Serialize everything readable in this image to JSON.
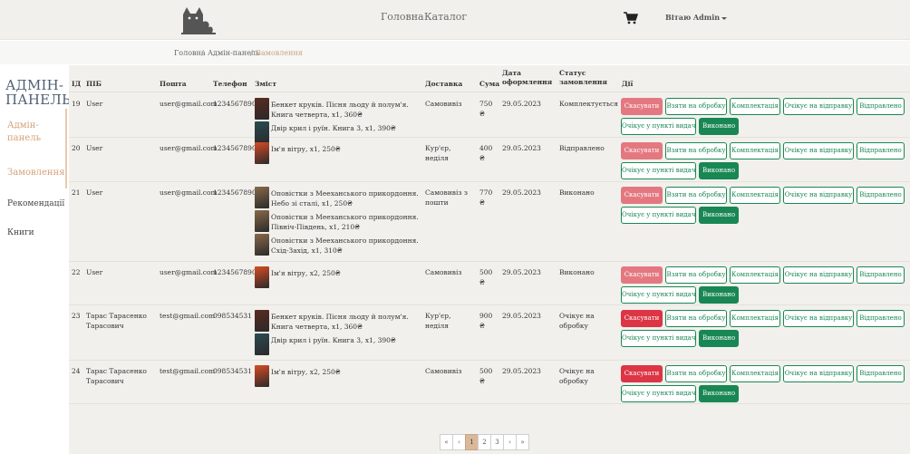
{
  "header": {
    "nav": [
      "Головна",
      "Каталог"
    ],
    "greeting": "Вітаю Admin"
  },
  "breadcrumb": [
    "Головна",
    "/",
    "Адмін-панель",
    "/",
    "Замовлення"
  ],
  "sidebar": {
    "title": "АДМІН-ПАНЕЛЬ",
    "items": [
      "Адмін-панель",
      "Замовлення",
      "Рекомендації",
      "Книги"
    ]
  },
  "table": {
    "headers": {
      "id": "ІД",
      "name": "ПІБ",
      "email": "Пошта",
      "phone": "Телефон",
      "content": "Зміст",
      "delivery": "Доставка",
      "sum": "Сума",
      "date": "Дата оформлення",
      "status": "Статус замовлення",
      "actions": "Дії"
    },
    "rows": [
      {
        "id": "19",
        "name": "User",
        "email": "user@gmail.com",
        "phone": "1234567890",
        "items": [
          "Бенкет круків. Пісня льоду й полум'я. Книга четверта, x1, 360₴",
          "Двір крил і руїн. Книга 3, x1, 390₴"
        ],
        "delivery": "Самовивіз",
        "sum": "750 ₴",
        "date": "29.05.2023",
        "status": "Комплектується"
      },
      {
        "id": "20",
        "name": "User",
        "email": "user@gmail.com",
        "phone": "1234567890",
        "items": [
          "Ім'я вітру, x1, 250₴"
        ],
        "delivery": "Кур'єр, неділя",
        "sum": "400 ₴",
        "date": "29.05.2023",
        "status": "Відправлено"
      },
      {
        "id": "21",
        "name": "User",
        "email": "user@gmail.com",
        "phone": "1234567890",
        "items": [
          "Оповістки з Мееханського прикордоння. Небо зі сталі, x1, 250₴",
          "Оповістки з Мееханського прикордоння. Північ-Південь, x1, 210₴",
          "Оповістки з Мееханського прикордоння. Схід-Захід, x1, 310₴"
        ],
        "delivery": "Самовивіз з пошти",
        "sum": "770 ₴",
        "date": "29.05.2023",
        "status": "Виконано"
      },
      {
        "id": "22",
        "name": "User",
        "email": "user@gmail.com",
        "phone": "1234567890",
        "items": [
          "Ім'я вітру, x2, 250₴"
        ],
        "delivery": "Самовивіз",
        "sum": "500 ₴",
        "date": "29.05.2023",
        "status": "Виконано"
      },
      {
        "id": "23",
        "name": "Тарас Тарасенко Тарасович",
        "email": "test@gmail.com",
        "phone": "098534531",
        "items": [
          "Бенкет круків. Пісня льоду й полум'я. Книга четверта, x1, 360₴",
          "Двір крил і руїн. Книга 3, x1, 390₴"
        ],
        "delivery": "Кур'єр, неділя",
        "sum": "900 ₴",
        "date": "29.05.2023",
        "status": "Очікує на обробку"
      },
      {
        "id": "24",
        "name": "Тарас Тарасенко Тарасович",
        "email": "test@gmail.com",
        "phone": "098534531",
        "items": [
          "Ім'я вітру, x2, 250₴"
        ],
        "delivery": "Самовивіз",
        "sum": "500 ₴",
        "date": "29.05.2023",
        "status": "Очікує на обробку"
      }
    ]
  },
  "actions": [
    "Скасувати",
    "Взяти на обробку",
    "Комплектація",
    "Очікує на відправку",
    "Відправлено",
    "Очікує у пункті видач",
    "Виконано"
  ],
  "pagination": [
    "«",
    "‹",
    "1",
    "2",
    "3",
    "›",
    "»"
  ],
  "colors": {
    "accent": "#d4a17a",
    "success": "#198754",
    "danger": "#dc3545"
  }
}
